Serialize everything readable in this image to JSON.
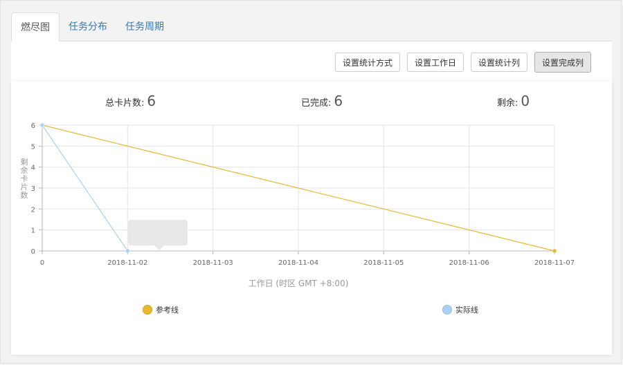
{
  "tabs": [
    {
      "label": "燃尽图",
      "active": true
    },
    {
      "label": "任务分布",
      "active": false
    },
    {
      "label": "任务周期",
      "active": false
    }
  ],
  "toolbar": {
    "buttons": [
      {
        "label": "设置统计方式",
        "pressed": false
      },
      {
        "label": "设置工作日",
        "pressed": false
      },
      {
        "label": "设置统计列",
        "pressed": false
      },
      {
        "label": "设置完成列",
        "pressed": true
      }
    ]
  },
  "stats": {
    "total_label": "总卡片数:",
    "total_value": "6",
    "done_label": "已完成:",
    "done_value": "6",
    "remaining_label": "剩余:",
    "remaining_value": "0"
  },
  "chart_data": {
    "type": "line",
    "xlabel": "工作日 (时区 GMT +8:00)",
    "ylabel": "剩余卡片数",
    "x": [
      "0",
      "2018-11-02",
      "2018-11-03",
      "2018-11-04",
      "2018-11-05",
      "2018-11-06",
      "2018-11-07"
    ],
    "ylim": [
      0,
      6
    ],
    "yticks": [
      0,
      1,
      2,
      3,
      4,
      5,
      6
    ],
    "grid": true,
    "legend_position": "bottom",
    "series": [
      {
        "name": "参考线",
        "color": "#e8b82e",
        "points": [
          [
            0,
            6
          ],
          [
            6,
            0
          ]
        ]
      },
      {
        "name": "实际线",
        "color": "#a9d3f2",
        "points": [
          [
            0,
            6
          ],
          [
            1,
            0
          ]
        ]
      }
    ]
  }
}
